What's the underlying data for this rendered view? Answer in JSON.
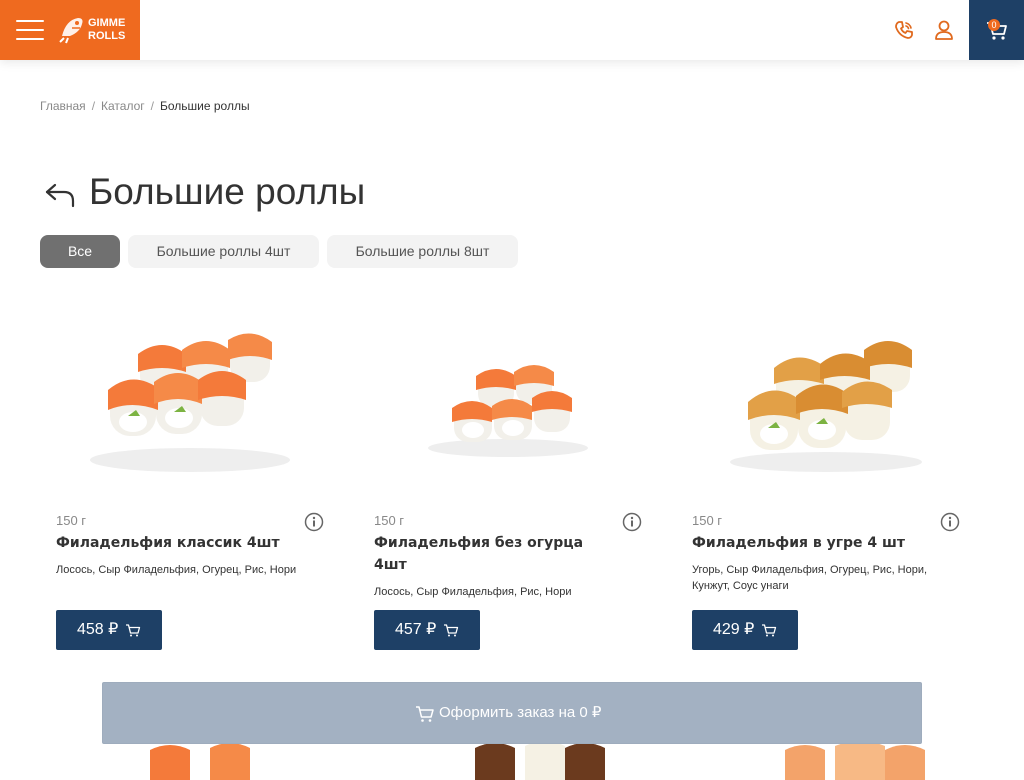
{
  "header": {
    "logo_text_line1": "GIMME",
    "logo_text_line2": "ROLLS",
    "icons": [
      "menu-icon",
      "phone-icon",
      "user-icon",
      "cart-icon"
    ],
    "cart_count": "0",
    "colors": {
      "brand_orange": "#ef6a1f",
      "navy": "#1e4066"
    }
  },
  "breadcrumb": {
    "items": [
      "Главная",
      "Каталог"
    ],
    "current": "Большие роллы",
    "separator": "/"
  },
  "page": {
    "title": "Большие роллы"
  },
  "filters": [
    {
      "label": "Все",
      "active": true
    },
    {
      "label": "Большие роллы 4шт",
      "active": false
    },
    {
      "label": "Большие роллы 8шт",
      "active": false
    }
  ],
  "products": [
    {
      "weight": "150 г",
      "name": "Филадельфия классик 4шт",
      "composition": "Лосось, Сыр Филадельфия, Огурец, Рис, Нори",
      "price": "458 ₽"
    },
    {
      "weight": "150 г",
      "name": "Филадельфия без огурца 4шт",
      "composition": "Лосось, Сыр Филадельфия, Рис, Нори",
      "price": "457 ₽"
    },
    {
      "weight": "150 г",
      "name": "Филадельфия в угре 4 шт",
      "composition": "Угорь, Сыр Филадельфия, Огурец, Рис, Нори, Кунжут, Соус унаги",
      "price": "429 ₽"
    }
  ],
  "order_bar": {
    "label": "Оформить заказ на 0 ₽"
  }
}
